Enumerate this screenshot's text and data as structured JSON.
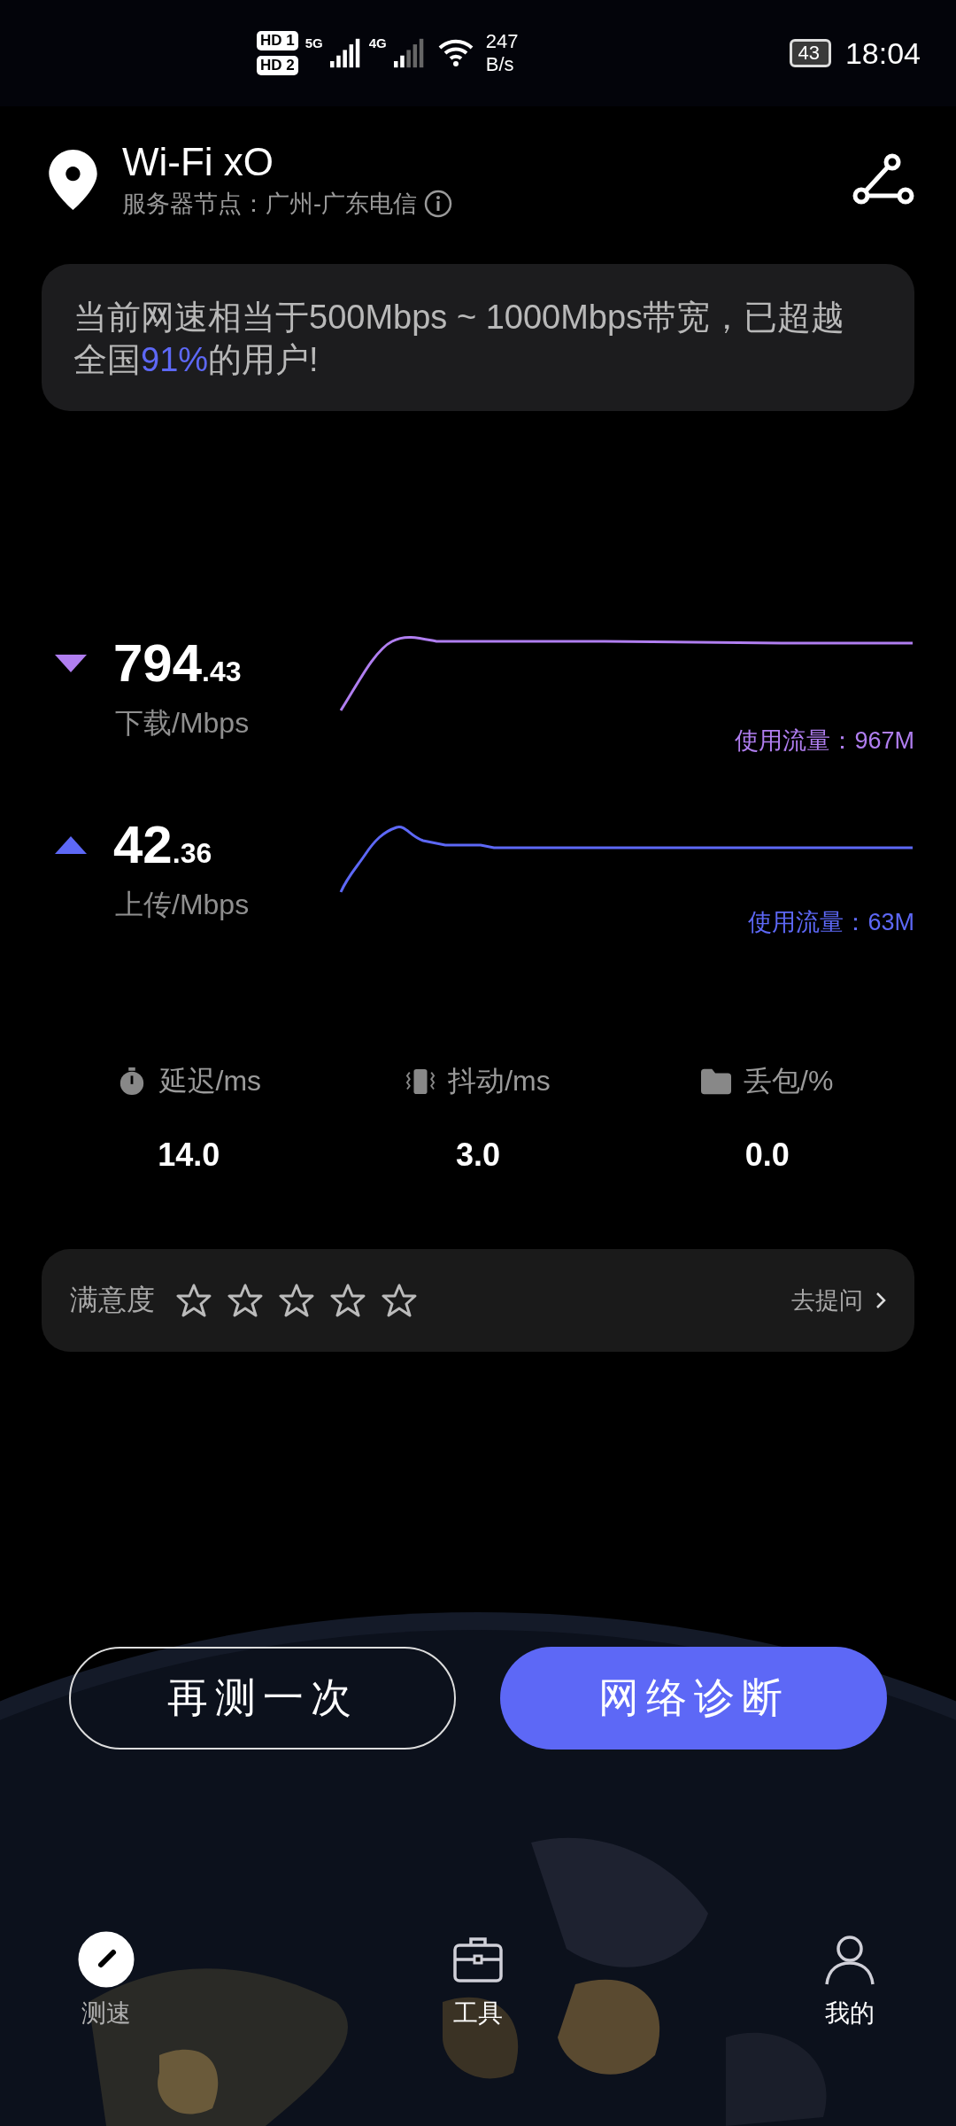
{
  "status_bar": {
    "sim_1": "HD 1",
    "sim_2": "HD 2",
    "net_1": "5G",
    "net_2": "4G",
    "speed_value": "247",
    "speed_unit": "B/s",
    "battery": "43",
    "time": "18:04"
  },
  "header": {
    "title": "Wi-Fi xO",
    "server": "服务器节点：广州-广东电信"
  },
  "summary": {
    "text_before": "当前网速相当于500Mbps ~ 1000Mbps带宽，已超越全国",
    "highlight": "91%",
    "text_after": "的用户!"
  },
  "speeds": [
    {
      "kind": "download",
      "integer": "794",
      "decimal": ".43",
      "label": "下载/Mbps",
      "usage": "使用流量：967M",
      "color": "#b07ef0"
    },
    {
      "kind": "upload",
      "integer": "42",
      "decimal": ".36",
      "label": "上传/Mbps",
      "usage": "使用流量：63M",
      "color": "#5d68f6"
    }
  ],
  "metrics": [
    {
      "kind": "latency",
      "label": "延迟/ms",
      "value": "14.0"
    },
    {
      "kind": "jitter",
      "label": "抖动/ms",
      "value": "3.0"
    },
    {
      "kind": "loss",
      "label": "丢包/%",
      "value": "0.0"
    }
  ],
  "rating": {
    "label": "满意度",
    "stars": 0,
    "link": "去提问"
  },
  "buttons": [
    {
      "kind": "outline",
      "label": "再测一次"
    },
    {
      "kind": "primary",
      "label": "网络诊断"
    }
  ],
  "nav": [
    {
      "kind": "speed",
      "label": "测速",
      "selected": true
    },
    {
      "kind": "tools",
      "label": "工具",
      "selected": false
    },
    {
      "kind": "me",
      "label": "我的",
      "selected": false
    }
  ]
}
